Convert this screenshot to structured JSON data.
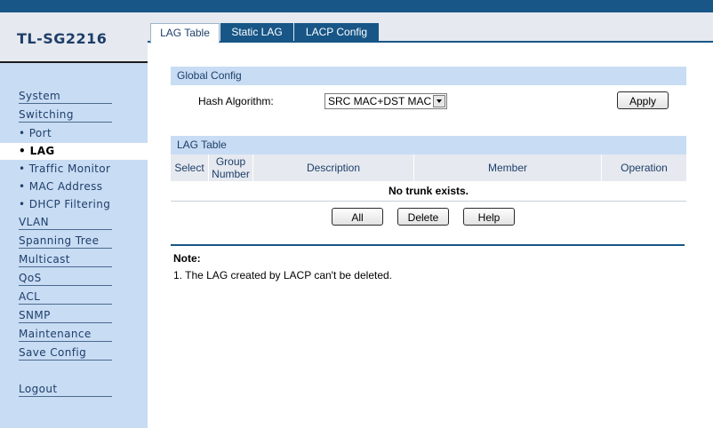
{
  "colors": {
    "primary": "#175686",
    "panel": "#c8dcf4",
    "section_bar": "#c8dcf4",
    "header_bg": "#e6e9ef"
  },
  "header": {
    "model": "TL-SG2216"
  },
  "sidebar": {
    "items": [
      {
        "label": "System"
      },
      {
        "label": "Switching"
      },
      {
        "label": "Port"
      },
      {
        "label": "LAG",
        "selected": true
      },
      {
        "label": "Traffic Monitor"
      },
      {
        "label": "MAC Address"
      },
      {
        "label": "DHCP Filtering"
      },
      {
        "label": "VLAN"
      },
      {
        "label": "Spanning Tree"
      },
      {
        "label": "Multicast"
      },
      {
        "label": "QoS"
      },
      {
        "label": "ACL"
      },
      {
        "label": "SNMP"
      },
      {
        "label": "Maintenance"
      },
      {
        "label": "Save Config"
      },
      {
        "label": "Logout"
      }
    ]
  },
  "tabs": [
    {
      "label": "LAG Table",
      "active": true
    },
    {
      "label": "Static LAG"
    },
    {
      "label": "LACP Config"
    }
  ],
  "global_config": {
    "title": "Global Config",
    "hash_label": "Hash Algorithm:",
    "hash_value": "SRC MAC+DST MAC",
    "apply_label": "Apply"
  },
  "lag_table": {
    "title": "LAG Table",
    "columns": {
      "select": "Select",
      "group_number_1": "Group",
      "group_number_2": "Number",
      "description": "Description",
      "member": "Member",
      "operation": "Operation"
    },
    "empty_text": "No trunk exists."
  },
  "actions": {
    "all": "All",
    "delete": "Delete",
    "help": "Help"
  },
  "note": {
    "title": "Note:",
    "items": [
      "1. The LAG created by LACP can't be deleted."
    ]
  }
}
